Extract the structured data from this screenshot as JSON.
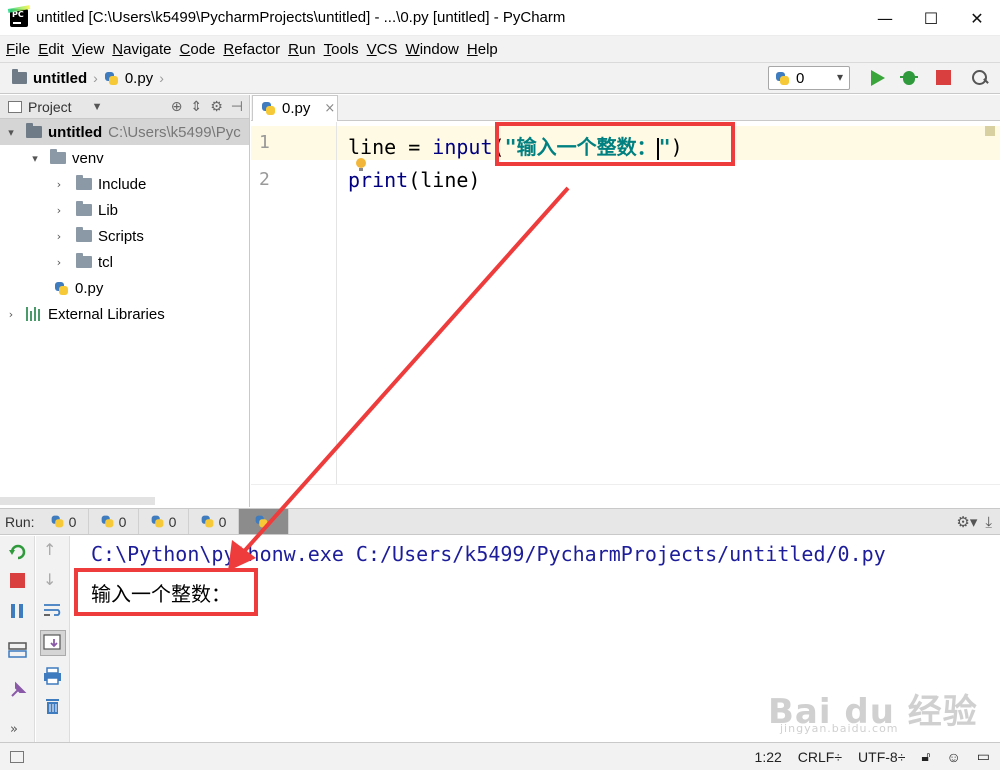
{
  "window": {
    "title": "untitled [C:\\Users\\k5499\\PycharmProjects\\untitled] - ...\\0.py [untitled] - PyCharm",
    "minimize": "—",
    "maximize": "☐",
    "close": "✕"
  },
  "menu": [
    "File",
    "Edit",
    "View",
    "Navigate",
    "Code",
    "Refactor",
    "Run",
    "Tools",
    "VCS",
    "Window",
    "Help"
  ],
  "navbar": {
    "project": "untitled",
    "file": "0.py",
    "run_config": "0"
  },
  "project_panel": {
    "header": "Project",
    "items": [
      {
        "label": "untitled",
        "extra": "C:\\Users\\k5499\\Pyc"
      },
      {
        "label": "venv"
      },
      {
        "label": "Include"
      },
      {
        "label": "Lib"
      },
      {
        "label": "Scripts"
      },
      {
        "label": "tcl"
      },
      {
        "label": "0.py"
      },
      {
        "label": "External Libraries"
      }
    ]
  },
  "editor": {
    "tab": "0.py",
    "lines": [
      {
        "number": "1",
        "pre": "line = ",
        "fn": "input",
        "open": "(",
        "str_open": "\"输入一个整数：",
        "str_close": "\"",
        "close": ")"
      },
      {
        "number": "2",
        "fn": "print",
        "rest": "(line)"
      }
    ]
  },
  "run": {
    "label": "Run:",
    "tabs": [
      "0",
      "0",
      "0",
      "0",
      ""
    ],
    "command": "C:\\Python\\pythonw.exe C:/Users/k5499/PycharmProjects/untitled/0.py",
    "output": "输入一个整数："
  },
  "status": {
    "position": "1:22",
    "line_sep": "CRLF÷",
    "encoding": "UTF-8÷"
  },
  "watermark": {
    "brand": "Bai  du 经验",
    "url": "jingyan.baidu.com"
  },
  "colors": {
    "highlight": "#ee3b3b",
    "keyword_fn": "#000080",
    "string": "#008080"
  }
}
